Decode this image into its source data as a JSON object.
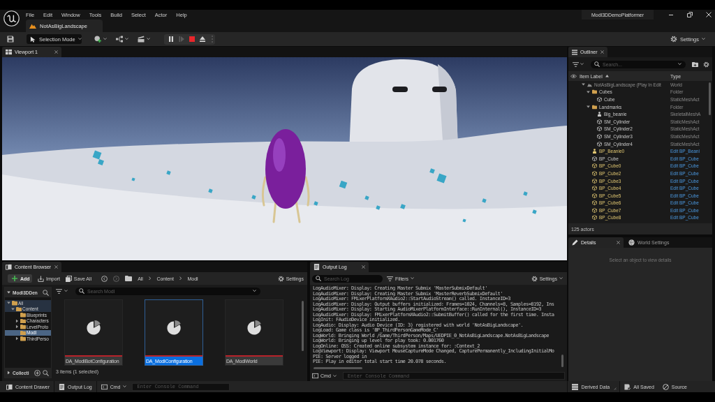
{
  "menu": [
    "File",
    "Edit",
    "Window",
    "Tools",
    "Build",
    "Select",
    "Actor",
    "Help"
  ],
  "level_tab": {
    "label": "NotAsBigLandscape"
  },
  "project_name": "Modl3DDemoPlatformer",
  "toolbar": {
    "mode": "Selection Mode",
    "play_controls": [
      {
        "kind": "pause",
        "disabled": false
      },
      {
        "kind": "step",
        "disabled": true
      },
      {
        "kind": "stop",
        "disabled": false
      },
      {
        "kind": "eject",
        "disabled": false
      }
    ],
    "settings": "Settings"
  },
  "viewport": {
    "tab": "Viewport 1"
  },
  "outliner": {
    "tab": "Outliner",
    "search": {
      "placeholder": "Search..."
    },
    "columns": [
      {
        "label": "Item Label",
        "sorted": true
      },
      {
        "label": "Type",
        "sorted": false
      }
    ],
    "rows": [
      {
        "label": "NotAsBigLandscape (Play In Edit",
        "type": "World",
        "kind": "world",
        "highlighted": false,
        "link": false,
        "expanded": true,
        "children": [
          {
            "label": "Cubes",
            "type": "Folder",
            "kind": "folder",
            "highlighted": false,
            "link": false,
            "expanded": true,
            "children": [
              {
                "label": "Cube",
                "type": "StaticMeshAct",
                "kind": "mesh",
                "highlighted": false,
                "link": false
              }
            ]
          },
          {
            "label": "Landmarks",
            "type": "Folder",
            "kind": "folder",
            "highlighted": false,
            "link": false,
            "expanded": true,
            "children": [
              {
                "label": "Big_beanie",
                "type": "SkeletalMeshA",
                "kind": "skeletal",
                "highlighted": false,
                "link": false
              },
              {
                "label": "SM_Cylinder",
                "type": "StaticMeshAct",
                "kind": "mesh",
                "highlighted": false,
                "link": false
              },
              {
                "label": "SM_Cylinder2",
                "type": "StaticMeshAct",
                "kind": "mesh",
                "highlighted": false,
                "link": false
              },
              {
                "label": "SM_Cylinder3",
                "type": "StaticMeshAct",
                "kind": "mesh",
                "highlighted": false,
                "link": false
              },
              {
                "label": "SM_Cylinder4",
                "type": "StaticMeshAct",
                "kind": "mesh",
                "highlighted": false,
                "link": false
              }
            ]
          },
          {
            "label": "BP_Beanie0",
            "type": "Edit BP_Beani",
            "kind": "skeletal",
            "highlighted": true,
            "link": true
          },
          {
            "label": "BP_Cube",
            "type": "Edit BP_Cube",
            "kind": "mesh",
            "highlighted": false,
            "link": true
          },
          {
            "label": "BP_Cube0",
            "type": "Edit BP_Cube",
            "kind": "mesh",
            "highlighted": true,
            "link": true
          },
          {
            "label": "BP_Cube2",
            "type": "Edit BP_Cube",
            "kind": "mesh",
            "highlighted": true,
            "link": true
          },
          {
            "label": "BP_Cube3",
            "type": "Edit BP_Cube",
            "kind": "mesh",
            "highlighted": true,
            "link": true
          },
          {
            "label": "BP_Cube4",
            "type": "Edit BP_Cube",
            "kind": "mesh",
            "highlighted": true,
            "link": true
          },
          {
            "label": "BP_Cube5",
            "type": "Edit BP_Cube",
            "kind": "mesh",
            "highlighted": true,
            "link": true
          },
          {
            "label": "BP_Cube6",
            "type": "Edit BP_Cube",
            "kind": "mesh",
            "highlighted": true,
            "link": true
          },
          {
            "label": "BP_Cube7",
            "type": "Edit BP_Cube",
            "kind": "mesh",
            "highlighted": true,
            "link": true
          },
          {
            "label": "BP_Cube8",
            "type": "Edit BP_Cube",
            "kind": "mesh",
            "highlighted": true,
            "link": true
          }
        ]
      }
    ],
    "footer": "125 actors"
  },
  "details": {
    "tabs": [
      {
        "label": "Details",
        "selected": true
      },
      {
        "label": "World Settings",
        "selected": false
      }
    ],
    "hint": "Select an object to view details"
  },
  "content_browser": {
    "tab": "Content Browser",
    "add": "Add",
    "import": "Import",
    "save_all": "Save All",
    "breadcrumb": [
      "All",
      "Content",
      "Modl"
    ],
    "settings": "Settings",
    "tree": {
      "title": "Modl3DDen",
      "expanded": true,
      "items": [
        {
          "label": "All",
          "expanded": true,
          "selected": false,
          "children": [
            {
              "label": "Content",
              "expanded": true,
              "selected": false,
              "children": [
                {
                  "label": "Blueprints",
                  "selected": false
                },
                {
                  "label": "Characters",
                  "expanded": false,
                  "selected": false
                },
                {
                  "label": "LevelProto",
                  "expanded": false,
                  "selected": false
                },
                {
                  "label": "Modl",
                  "selected": true
                },
                {
                  "label": "ThirdPerso",
                  "expanded": false,
                  "selected": false
                }
              ]
            }
          ]
        }
      ]
    },
    "collections": {
      "label": "Collecti",
      "expanded": false
    },
    "search": {
      "placeholder": "Search Modl"
    },
    "assets": [
      {
        "name": "DA_ModlBotConfiguration",
        "selected": false
      },
      {
        "name": "DA_ModlConfiguration",
        "selected": true
      },
      {
        "name": "DA_ModlWorld",
        "selected": false
      }
    ],
    "status": "3 items (1 selected)"
  },
  "output_log": {
    "tab": "Output Log",
    "search": {
      "placeholder": "Search Log"
    },
    "filters": "Filters",
    "settings": "Settings",
    "lines": [
      "LogAudioMixer: Display: Creating Master Submix 'MasterSubmixDefault'",
      "LogAudioMixer: Display: Creating Master Submix 'MasterReverbSubmixDefault'",
      "LogAudioMixer: FMixerPlatformXAudio2::StartAudioStream() called. InstanceID=3",
      "LogAudioMixer: Display: Output buffers initialized: Frames=1024, Channels=8, Samples=8192, Ins",
      "LogAudioMixer: Display: Starting AudioMixerPlatformInterface::RunInternal(), InstanceID=3",
      "LogAudioMixer: Display: FMixerPlatformXAudio2::SubmitBuffer() called for the first time. Insta",
      "LogInit: FAudioDevice initialized.",
      "LogAudio: Display: Audio Device (ID: 3) registered with world 'NotAsBigLandscape'.",
      "LogLoad: Game class is 'BP_ThirdPersonGameMode_C'",
      "LogWorld: Bringing World /Game/ThirdPerson/Maps/UEDPIE_0_NotAsBigLandscape.NotAsBigLandscape",
      "LogWorld: Bringing up level for play took: 0.001760",
      "LogOnline: OSS: Created online subsystem instance for: :Context_2",
      "LogViewport: Display: Viewport MouseCaptureMode Changed, CapturePermanently_IncludingInitialMo",
      "PIE: Server logged in",
      "PIE: Play in editor total start time 20.078 seconds."
    ],
    "cmd": "Cmd",
    "console": {
      "placeholder": "Enter Console Command"
    }
  },
  "status_bar": {
    "content_drawer": "Content Drawer",
    "output_log": "Output Log",
    "cmd": "Cmd",
    "console": {
      "placeholder": "Enter Console Command"
    },
    "derived_data": "Derived Data",
    "saved": "All Saved",
    "source": "Source"
  }
}
